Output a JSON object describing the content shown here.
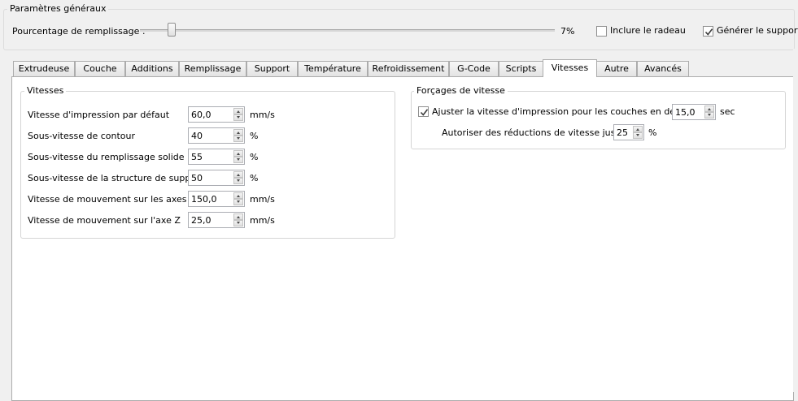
{
  "general": {
    "title": "Paramètres généraux",
    "fill_label": "Pourcentage de remplissage :",
    "fill_value": 7,
    "fill_display": "7%",
    "raft_label": "Inclure le radeau",
    "raft_checked": false,
    "support_label": "Générer le support",
    "support_checked": true
  },
  "tabs": [
    {
      "label": "Extrudeuse",
      "active": false
    },
    {
      "label": "Couche",
      "active": false
    },
    {
      "label": "Additions",
      "active": false
    },
    {
      "label": "Remplissage",
      "active": false
    },
    {
      "label": "Support",
      "active": false
    },
    {
      "label": "Température",
      "active": false
    },
    {
      "label": "Refroidissement",
      "active": false
    },
    {
      "label": "G-Code",
      "active": false
    },
    {
      "label": "Scripts",
      "active": false
    },
    {
      "label": "Vitesses",
      "active": true
    },
    {
      "label": "Autre",
      "active": false
    },
    {
      "label": "Avancés",
      "active": false
    }
  ],
  "speeds": {
    "title": "Vitesses",
    "rows": [
      {
        "label": "Vitesse d'impression par défaut",
        "value": "60,0",
        "unit": "mm/s"
      },
      {
        "label": "Sous-vitesse de contour",
        "value": "40",
        "unit": "%"
      },
      {
        "label": "Sous-vitesse du remplissage solide",
        "value": "55",
        "unit": "%"
      },
      {
        "label": "Sous-vitesse de la structure de support",
        "value": "50",
        "unit": "%"
      },
      {
        "label": "Vitesse de mouvement sur les axes X/Y",
        "value": "150,0",
        "unit": "mm/s"
      },
      {
        "label": "Vitesse de mouvement sur l'axe Z",
        "value": "25,0",
        "unit": "mm/s"
      }
    ]
  },
  "overrides": {
    "title": "Forçages de vitesse",
    "adjust_label": "Ajuster la vitesse d'impression pour les couches en dessous",
    "adjust_checked": true,
    "adjust_value": "15,0",
    "adjust_unit": "sec",
    "reduce_label": "Autoriser des réductions de vitesse jusqu'à",
    "reduce_value": "25",
    "reduce_unit": "%"
  }
}
